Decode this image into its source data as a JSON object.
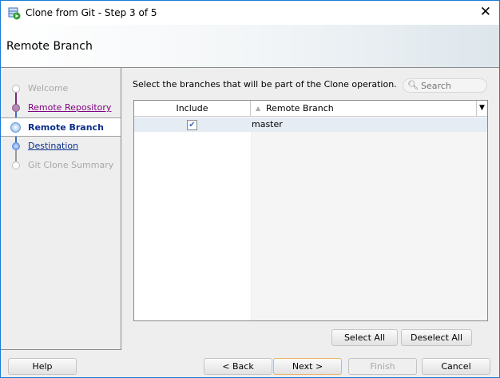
{
  "window": {
    "title": "Clone from Git - Step 3 of 5"
  },
  "header": {
    "title": "Remote Branch"
  },
  "nav": {
    "items": [
      {
        "label": "Welcome",
        "state": "disabled"
      },
      {
        "label": "Remote Repository",
        "state": "visited"
      },
      {
        "label": "Remote Branch",
        "state": "current"
      },
      {
        "label": "Destination",
        "state": "link"
      },
      {
        "label": "Git Clone Summary",
        "state": "disabled"
      }
    ]
  },
  "main": {
    "description": "Select the branches that will be part of the Clone operation.",
    "search": {
      "placeholder": "Search",
      "value": ""
    },
    "table": {
      "columns": [
        "Include",
        "Remote Branch"
      ],
      "rows": [
        {
          "include": true,
          "branch": "master"
        }
      ]
    },
    "select_all": "Select All",
    "deselect_all": "Deselect All"
  },
  "footer": {
    "help": "Help",
    "back": "< Back",
    "next": "Next >",
    "finish": "Finish",
    "cancel": "Cancel"
  },
  "colors": {
    "accent": "#1a7ad4",
    "current": "#0a2e8a",
    "visited": "#800080",
    "link": "#0a2e8a",
    "disabled": "#a8a8a8"
  }
}
